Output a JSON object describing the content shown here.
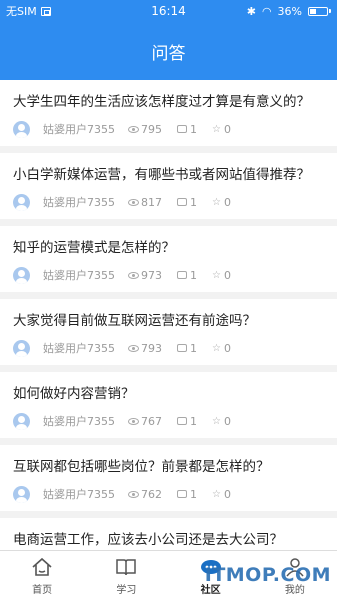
{
  "status_bar": {
    "carrier": "无SIM",
    "time": "16:14",
    "battery": "36%"
  },
  "header": {
    "title": "问答"
  },
  "questions": [
    {
      "title": "大学生四年的生活应该怎样度过才算是有意义的？",
      "user": "姑婆用户7355",
      "views": "795",
      "comments": "1",
      "stars": "0"
    },
    {
      "title": "小白学新媒体运营，有哪些书或者网站值得推荐？",
      "user": "姑婆用户7355",
      "views": "817",
      "comments": "1",
      "stars": "0"
    },
    {
      "title": "知乎的运营模式是怎样的？",
      "user": "姑婆用户7355",
      "views": "973",
      "comments": "1",
      "stars": "0"
    },
    {
      "title": "大家觉得目前做互联网运营还有前途吗？",
      "user": "姑婆用户7355",
      "views": "793",
      "comments": "1",
      "stars": "0"
    },
    {
      "title": "如何做好内容营销？",
      "user": "姑婆用户7355",
      "views": "767",
      "comments": "1",
      "stars": "0"
    },
    {
      "title": "互联网都包括哪些岗位？前景都是怎样的？",
      "user": "姑婆用户7355",
      "views": "762",
      "comments": "1",
      "stars": "0"
    },
    {
      "title": "电商运营工作，应该去小公司还是去大公司？",
      "user": "",
      "views": "",
      "comments": "",
      "stars": ""
    }
  ],
  "tabbar": {
    "items": [
      {
        "label": "首页",
        "icon": "home-icon"
      },
      {
        "label": "学习",
        "icon": "book-icon"
      },
      {
        "label": "社区",
        "icon": "community-icon"
      },
      {
        "label": "我的",
        "icon": "profile-icon"
      }
    ]
  },
  "watermark": {
    "text": "ITMOP.COM"
  },
  "colors": {
    "brand": "#2e8cf0",
    "background": "#f2f2f2",
    "text": "#222222",
    "meta": "#9a9a9a"
  }
}
